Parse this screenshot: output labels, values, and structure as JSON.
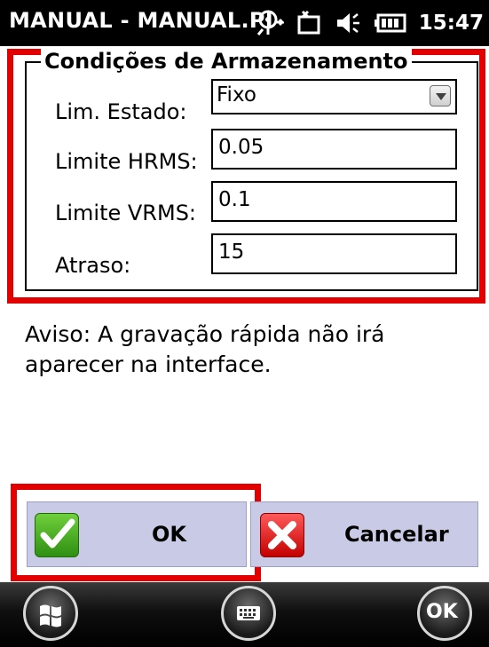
{
  "window": {
    "title": "MANUAL - MANUAL.PI",
    "time": "15:47",
    "status_icons": [
      "signal-icon",
      "connectivity-icon",
      "volume-icon",
      "battery-icon"
    ]
  },
  "form": {
    "group_title": "Condições de Armazenamento",
    "fields": [
      {
        "label": "Lim. Estado:",
        "value": "Fixo",
        "type": "dropdown"
      },
      {
        "label": "Limite HRMS:",
        "value": "0.05",
        "type": "text"
      },
      {
        "label": "Limite VRMS:",
        "value": "0.1",
        "type": "text"
      },
      {
        "label": "Atraso:",
        "value": "15",
        "type": "text"
      }
    ]
  },
  "warning_text": "Aviso: A gravação rápida não irá aparecer na interface.",
  "buttons": {
    "ok": {
      "label": "OK",
      "icon": "checkmark-icon"
    },
    "cancel": {
      "label": "Cancelar",
      "icon": "x-icon"
    }
  },
  "taskbar": {
    "start_icon": "windows-logo-icon",
    "keyboard_icon": "keyboard-icon",
    "ok_label": "OK"
  },
  "colors": {
    "highlight": "#e30000",
    "button_bg": "#c9cbe6",
    "title_bar": "#000000"
  }
}
